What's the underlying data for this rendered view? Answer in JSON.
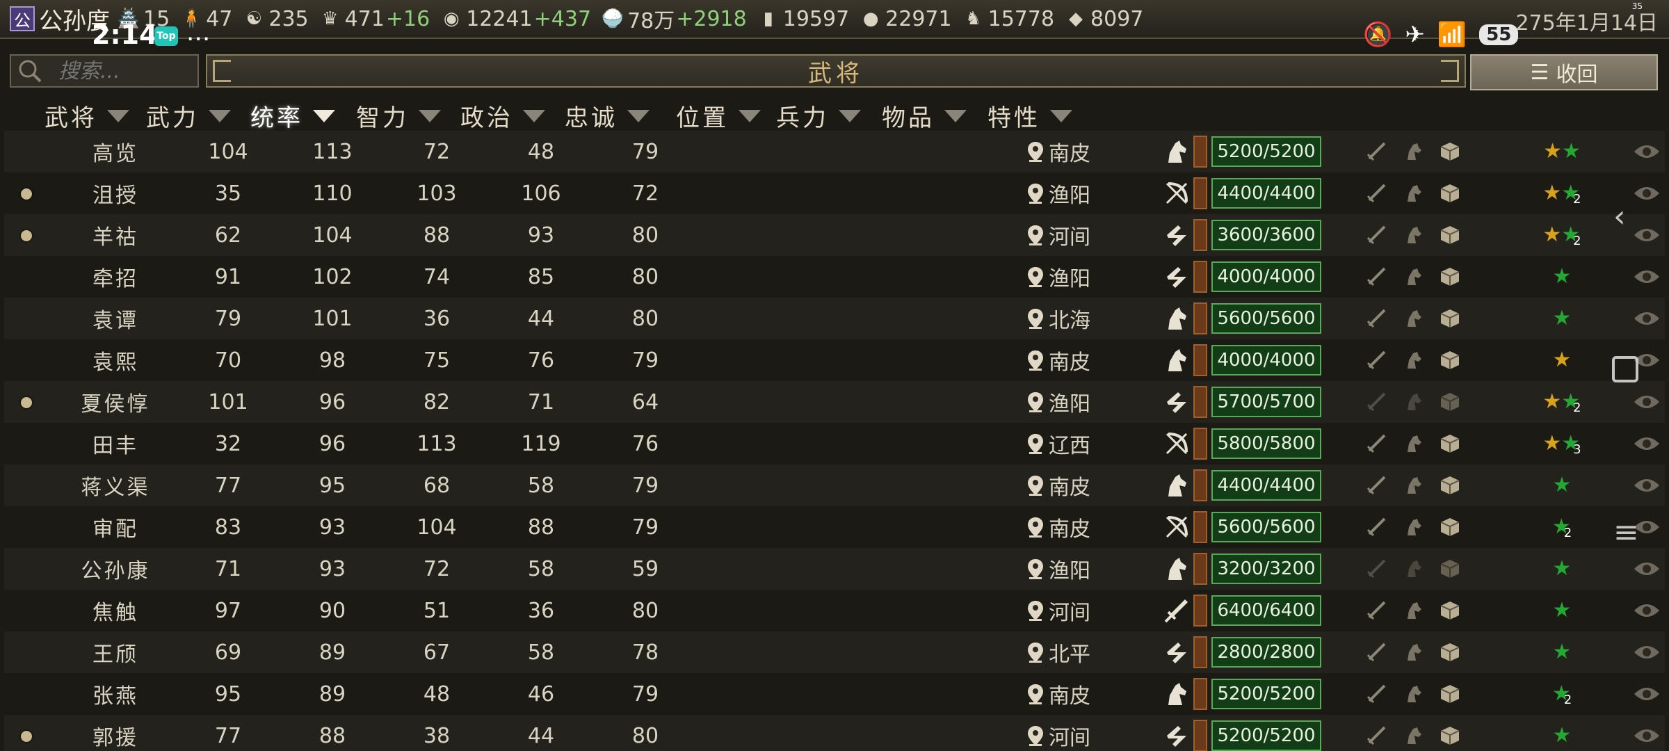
{
  "status": {
    "time": "2:14",
    "top_badge": "Top",
    "ellipsis": "...",
    "battery": "55",
    "small_number": "35"
  },
  "faction": {
    "badge": "公",
    "name": "公孙度"
  },
  "resources": [
    {
      "icon": "building-icon",
      "glyph": "🏯",
      "value": "15",
      "gain": ""
    },
    {
      "icon": "person-icon",
      "glyph": "🧍",
      "value": "47",
      "gain": ""
    },
    {
      "icon": "yinyang-icon",
      "glyph": "☯",
      "value": "235",
      "gain": ""
    },
    {
      "icon": "crown-icon",
      "glyph": "♛",
      "value": "471",
      "gain": "+16"
    },
    {
      "icon": "coin-icon",
      "glyph": "◉",
      "value": "12241",
      "gain": "+437"
    },
    {
      "icon": "rice-icon",
      "glyph": "🍚",
      "value": "78万",
      "gain": "+2918"
    },
    {
      "icon": "wood-icon",
      "glyph": "▮",
      "value": "19597",
      "gain": ""
    },
    {
      "icon": "stone-icon",
      "glyph": "●",
      "value": "22971",
      "gain": ""
    },
    {
      "icon": "horse-icon",
      "glyph": "♞",
      "value": "15778",
      "gain": ""
    },
    {
      "icon": "iron-icon",
      "glyph": "◆",
      "value": "8097",
      "gain": ""
    }
  ],
  "date": "275年1月14日",
  "search": {
    "placeholder": "搜索..."
  },
  "title": "武将",
  "collapse_label": "收回",
  "columns": [
    "武将",
    "武力",
    "统率",
    "智力",
    "政治",
    "忠诚",
    "位置",
    "兵力",
    "物品",
    "特性"
  ],
  "sorted_column": 2,
  "rows": [
    {
      "dot": false,
      "name": "高览",
      "wu": "104",
      "tong": "113",
      "zhi": "72",
      "zheng": "48",
      "zhong": "79",
      "loc": "南皮",
      "unit": "cavalry",
      "troops": "5200/5200",
      "items_active": true,
      "traits": [
        "gold",
        "green"
      ],
      "badge": ""
    },
    {
      "dot": true,
      "name": "沮授",
      "wu": "35",
      "tong": "110",
      "zhi": "103",
      "zheng": "106",
      "zhong": "72",
      "loc": "渔阳",
      "unit": "archer",
      "troops": "4400/4400",
      "items_active": true,
      "traits": [
        "gold",
        "green"
      ],
      "badge": "2"
    },
    {
      "dot": true,
      "name": "羊祜",
      "wu": "62",
      "tong": "104",
      "zhi": "88",
      "zheng": "93",
      "zhong": "80",
      "loc": "河间",
      "unit": "spear",
      "troops": "3600/3600",
      "items_active": true,
      "traits": [
        "gold",
        "green"
      ],
      "badge": "2"
    },
    {
      "dot": false,
      "name": "牵招",
      "wu": "91",
      "tong": "102",
      "zhi": "74",
      "zheng": "85",
      "zhong": "80",
      "loc": "渔阳",
      "unit": "spear",
      "troops": "4000/4000",
      "items_active": true,
      "traits": [
        "green"
      ],
      "badge": ""
    },
    {
      "dot": false,
      "name": "袁谭",
      "wu": "79",
      "tong": "101",
      "zhi": "36",
      "zheng": "44",
      "zhong": "80",
      "loc": "北海",
      "unit": "cavalry",
      "troops": "5600/5600",
      "items_active": true,
      "traits": [
        "green"
      ],
      "badge": ""
    },
    {
      "dot": false,
      "name": "袁熙",
      "wu": "70",
      "tong": "98",
      "zhi": "75",
      "zheng": "76",
      "zhong": "79",
      "loc": "南皮",
      "unit": "cavalry",
      "troops": "4000/4000",
      "items_active": true,
      "traits": [
        "gold"
      ],
      "badge": ""
    },
    {
      "dot": true,
      "name": "夏侯惇",
      "wu": "101",
      "tong": "96",
      "zhi": "82",
      "zheng": "71",
      "zhong": "64",
      "loc": "渔阳",
      "unit": "spear",
      "troops": "5700/5700",
      "items_active": false,
      "traits": [
        "gold",
        "green"
      ],
      "badge": "2"
    },
    {
      "dot": false,
      "name": "田丰",
      "wu": "32",
      "tong": "96",
      "zhi": "113",
      "zheng": "119",
      "zhong": "76",
      "loc": "辽西",
      "unit": "archer",
      "troops": "5800/5800",
      "items_active": true,
      "traits": [
        "gold",
        "green"
      ],
      "badge": "3"
    },
    {
      "dot": false,
      "name": "蒋义渠",
      "wu": "77",
      "tong": "95",
      "zhi": "68",
      "zheng": "58",
      "zhong": "79",
      "loc": "南皮",
      "unit": "cavalry",
      "troops": "4400/4400",
      "items_active": true,
      "traits": [
        "green"
      ],
      "badge": ""
    },
    {
      "dot": false,
      "name": "审配",
      "wu": "83",
      "tong": "93",
      "zhi": "104",
      "zheng": "88",
      "zhong": "79",
      "loc": "南皮",
      "unit": "archer",
      "troops": "5600/5600",
      "items_active": true,
      "traits": [
        "green"
      ],
      "badge": "2"
    },
    {
      "dot": false,
      "name": "公孙康",
      "wu": "71",
      "tong": "93",
      "zhi": "72",
      "zheng": "58",
      "zhong": "59",
      "loc": "渔阳",
      "unit": "cavalry",
      "troops": "3200/3200",
      "items_active": false,
      "traits": [
        "green"
      ],
      "badge": ""
    },
    {
      "dot": false,
      "name": "焦触",
      "wu": "97",
      "tong": "90",
      "zhi": "51",
      "zheng": "36",
      "zhong": "80",
      "loc": "河间",
      "unit": "sword",
      "troops": "6400/6400",
      "items_active": true,
      "traits": [
        "green"
      ],
      "badge": ""
    },
    {
      "dot": false,
      "name": "王颀",
      "wu": "69",
      "tong": "89",
      "zhi": "67",
      "zheng": "58",
      "zhong": "78",
      "loc": "北平",
      "unit": "spear",
      "troops": "2800/2800",
      "items_active": true,
      "traits": [
        "green"
      ],
      "badge": ""
    },
    {
      "dot": false,
      "name": "张燕",
      "wu": "95",
      "tong": "89",
      "zhi": "48",
      "zheng": "46",
      "zhong": "79",
      "loc": "南皮",
      "unit": "cavalry",
      "troops": "5200/5200",
      "items_active": true,
      "traits": [
        "green"
      ],
      "badge": "2"
    },
    {
      "dot": true,
      "name": "郭援",
      "wu": "77",
      "tong": "88",
      "zhi": "38",
      "zheng": "44",
      "zhong": "80",
      "loc": "河间",
      "unit": "spear",
      "troops": "5200/5200",
      "items_active": true,
      "traits": [
        "green"
      ],
      "badge": ""
    }
  ],
  "colors": {
    "troop_fill": "#123d16",
    "troop_border": "#5ba85a",
    "star_gold": "#d8a21c",
    "star_green": "#25a833"
  }
}
